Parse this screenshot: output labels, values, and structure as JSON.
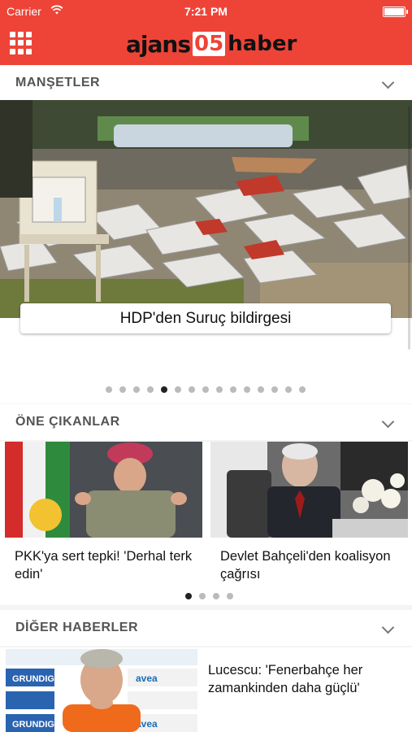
{
  "status": {
    "carrier": "Carrier",
    "time": "7:21 PM"
  },
  "header": {
    "logo_part1": "ajans",
    "logo_part2": "05",
    "logo_part3": "haber"
  },
  "sections": {
    "headlines_title": "MANŞETLER",
    "featured_title": "ÖNE ÇIKANLAR",
    "other_title": "DİĞER HABERLER"
  },
  "hero": {
    "caption": "HDP'den Suruç bildirgesi",
    "page_count": 15,
    "active_page": 5
  },
  "featured": {
    "cards": [
      {
        "title": "PKK'ya sert tepki! 'Derhal terk edin'"
      },
      {
        "title": "Devlet Bahçeli'den koalisyon çağrısı"
      }
    ],
    "page_count": 4,
    "active_page": 1
  },
  "other_news": [
    {
      "title": "Lucescu: 'Fenerbahçe her zamankinden daha güçlü'",
      "sponsor_labels": [
        "GRUNDIG",
        "avea",
        "GRUNDIG",
        "avea"
      ]
    }
  ],
  "colors": {
    "brand": "#ee4437"
  }
}
